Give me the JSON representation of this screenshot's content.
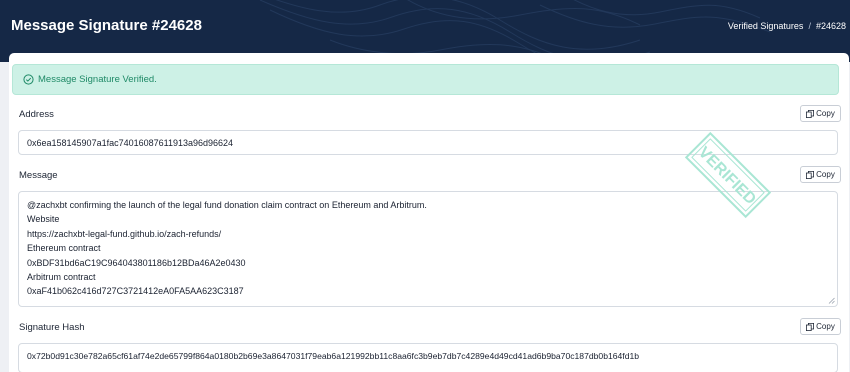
{
  "header": {
    "title": "Message Signature #24628",
    "breadcrumb": {
      "link": "Verified Signatures",
      "separator": "/",
      "current": "#24628"
    }
  },
  "alert": {
    "text": "Message Signature Verified.",
    "icon": "check-circle-icon",
    "color": "#1f8a67"
  },
  "address": {
    "label": "Address",
    "value": "0x6ea158145907a1fac74016087611913a96d96624",
    "copy_label": "Copy"
  },
  "message": {
    "label": "Message",
    "copy_label": "Copy",
    "lines": [
      "@zachxbt confirming the launch of the legal fund donation claim contract on Ethereum and Arbitrum.",
      "Website",
      "https://zachxbt-legal-fund.github.io/zach-refunds/",
      "Ethereum contract",
      "0xBDF31bd6aC19C964043801186b12BDa46A2e0430",
      "Arbitrum contract",
      "0xaF41b062c416d727C3721412eA0FA5AA623C3187"
    ]
  },
  "signature": {
    "label": "Signature Hash",
    "copy_label": "Copy",
    "value": "0x72b0d91c30e782a65cf61af74e2de65799f864a0180b2b69e3a8647031f79eab6a121992bb11c8aa6fc3b9eb7db7c4289e4d49cd41ad6b9ba70c187db0b164fd1b"
  },
  "stamp": {
    "text": "VERIFIED",
    "color": "#9ee3cf"
  }
}
